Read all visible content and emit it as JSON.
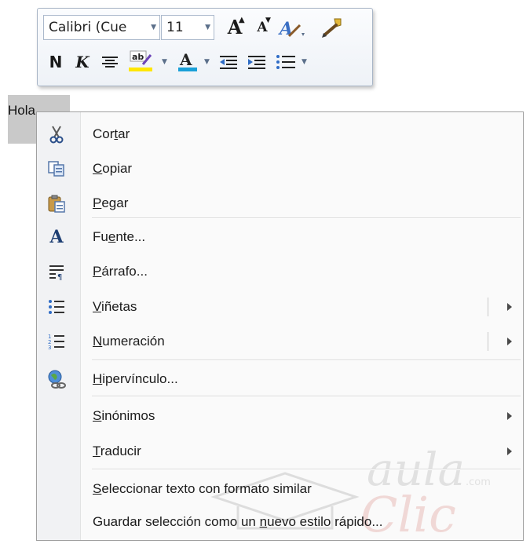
{
  "mini_toolbar": {
    "font_name": "Calibri (Cue",
    "font_size": "11",
    "grow_font_glyph": "A",
    "shrink_font_glyph": "A",
    "bold_glyph": "N",
    "italic_glyph": "K",
    "highlight_glyph": "ab",
    "font_color_glyph": "A",
    "highlight_color": "#ffe600",
    "font_color_bar": "#1aa0d8"
  },
  "document": {
    "selected_text": "Hola"
  },
  "context_menu": {
    "items": [
      {
        "before": "Cor",
        "mnemonic": "t",
        "after": "ar",
        "icon": "scissors-icon"
      },
      {
        "before": "",
        "mnemonic": "C",
        "after": "opiar",
        "icon": "copy-icon"
      },
      {
        "before": "",
        "mnemonic": "P",
        "after": "egar",
        "icon": "paste-icon"
      },
      {
        "before": "Fu",
        "mnemonic": "e",
        "after": "nte...",
        "icon": "font-icon",
        "icon_glyph": "A"
      },
      {
        "before": "",
        "mnemonic": "P",
        "after": "árrafo...",
        "icon": "paragraph-icon"
      },
      {
        "before": "",
        "mnemonic": "V",
        "after": "iñetas",
        "icon": "bullets-icon"
      },
      {
        "before": "",
        "mnemonic": "N",
        "after": "umeración",
        "icon": "numbering-icon"
      },
      {
        "before": "",
        "mnemonic": "H",
        "after": "ipervínculo...",
        "icon": "hyperlink-icon"
      },
      {
        "before": "",
        "mnemonic": "S",
        "after": "inónimos"
      },
      {
        "before": "",
        "mnemonic": "T",
        "after": "raducir"
      },
      {
        "before": "",
        "mnemonic": "S",
        "after": "eleccionar texto con formato similar"
      },
      {
        "before": "Guardar selección como un ",
        "mnemonic": "n",
        "after": "uevo estilo rápido..."
      }
    ]
  },
  "watermark": {
    "line1": "aula",
    "line2": "Clic",
    "suffix": ".com"
  }
}
